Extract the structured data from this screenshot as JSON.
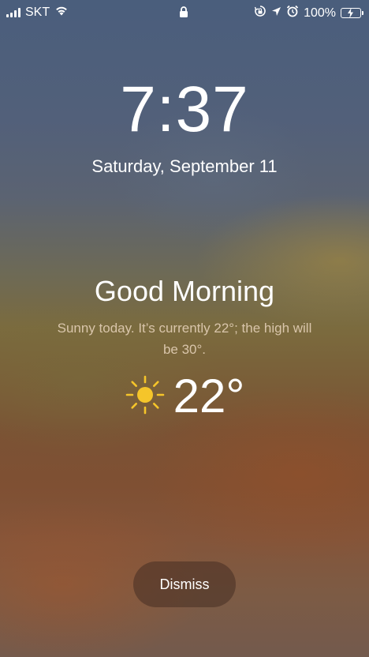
{
  "status_bar": {
    "carrier": "SKT",
    "battery_percent": "100%",
    "battery_level": 1.0,
    "icons": [
      "signal-icon",
      "wifi-icon",
      "lock-icon",
      "orientation-lock-icon",
      "location-icon",
      "alarm-icon",
      "battery-charging-icon"
    ],
    "battery_color": "#4cd964"
  },
  "lock_screen": {
    "time": "7:37",
    "date": "Saturday, September 11"
  },
  "wake_screen": {
    "greeting": "Good Morning",
    "summary": "Sunny today. It’s currently 22°; the high will be 30°.",
    "weather_icon": "sun-icon",
    "temperature": "22°",
    "sun_color": "#f5c52a",
    "dismiss_label": "Dismiss"
  }
}
